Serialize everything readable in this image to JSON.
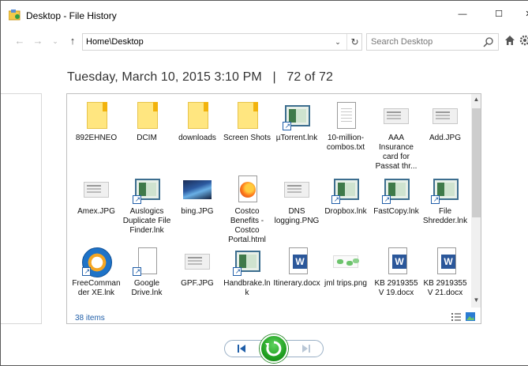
{
  "window": {
    "title": "Desktop - File History",
    "min_glyph": "—",
    "max_glyph": "☐",
    "close_glyph": "✕"
  },
  "nav": {
    "back": "←",
    "forward": "→",
    "recent": "⌄",
    "up": "↑",
    "address": "Home\\Desktop",
    "address_dropdown": "⌄",
    "refresh": "↻",
    "search_placeholder": "Search Desktop"
  },
  "heading": {
    "datetime": "Tuesday, March 10, 2015 3:10 PM",
    "separator": "|",
    "position": "72 of 72"
  },
  "items": [
    {
      "label": "892EHNEO",
      "icon": "folder-icon"
    },
    {
      "label": "DCIM",
      "icon": "folder-icon"
    },
    {
      "label": "downloads",
      "icon": "folder-icon"
    },
    {
      "label": "Screen Shots",
      "icon": "folder-icon"
    },
    {
      "label": "µTorrent.lnk",
      "icon": "app-shortcut-icon"
    },
    {
      "label": "10-million-combos.txt",
      "icon": "text-file-icon"
    },
    {
      "label": "AAA Insurance card for Passat thr...",
      "icon": "image-thumbnail-icon"
    },
    {
      "label": "Add.JPG",
      "icon": "image-thumbnail-icon"
    },
    {
      "label": "Amex.JPG",
      "icon": "image-thumbnail-icon"
    },
    {
      "label": "Auslogics Duplicate File Finder.lnk",
      "icon": "app-shortcut-icon"
    },
    {
      "label": "bing.JPG",
      "icon": "photo-thumbnail-icon"
    },
    {
      "label": "Costco Benefits - Costco Portal.html",
      "icon": "firefox-html-icon"
    },
    {
      "label": "DNS logging.PNG",
      "icon": "image-thumbnail-icon"
    },
    {
      "label": "Dropbox.lnk",
      "icon": "app-shortcut-icon"
    },
    {
      "label": "FastCopy.lnk",
      "icon": "app-shortcut-icon"
    },
    {
      "label": "File Shredder.lnk",
      "icon": "app-shortcut-icon"
    },
    {
      "label": "FreeCommander XE.lnk",
      "icon": "freecommander-icon"
    },
    {
      "label": "Google Drive.lnk",
      "icon": "blank-shortcut-icon"
    },
    {
      "label": "GPF.JPG",
      "icon": "image-thumbnail-icon"
    },
    {
      "label": "Handbrake.lnk",
      "icon": "app-shortcut-icon"
    },
    {
      "label": "Itinerary.docx",
      "icon": "word-doc-icon"
    },
    {
      "label": "jml trips.png",
      "icon": "map-thumbnail-icon"
    },
    {
      "label": "KB 2919355 V 19.docx",
      "icon": "word-doc-icon"
    },
    {
      "label": "KB 2919355 V 21.docx",
      "icon": "word-doc-icon"
    }
  ],
  "status": {
    "count": "38 items"
  },
  "scroll": {
    "up": "▲",
    "down": "▼"
  },
  "colors": {
    "accent": "#1f5ea8",
    "restore_green": "#21a121",
    "folder_yellow": "#ffe680"
  }
}
